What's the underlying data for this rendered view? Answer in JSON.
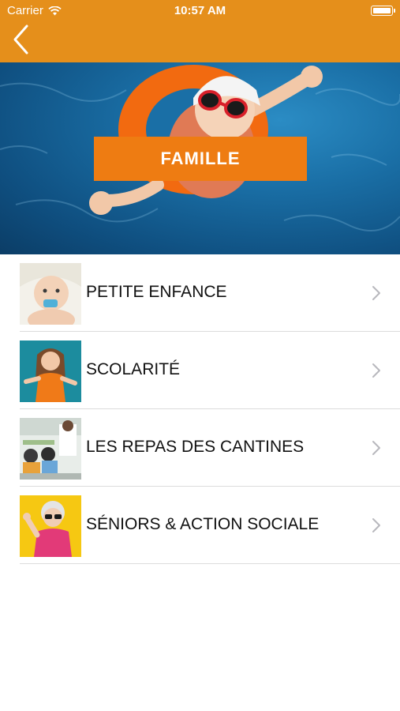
{
  "status_bar": {
    "carrier": "Carrier",
    "time": "10:57 AM"
  },
  "nav": {
    "back_icon": "chevron-left-icon",
    "bar_color": "#e58f1b"
  },
  "banner": {
    "title": "FAMILLE",
    "label_color": "#ee7c12"
  },
  "menu": {
    "items": [
      {
        "label": "PETITE ENFANCE"
      },
      {
        "label": "SCOLARITÉ"
      },
      {
        "label": "LES REPAS DES CANTINES"
      },
      {
        "label": "SÉNIORS & ACTION SOCIALE"
      }
    ]
  }
}
